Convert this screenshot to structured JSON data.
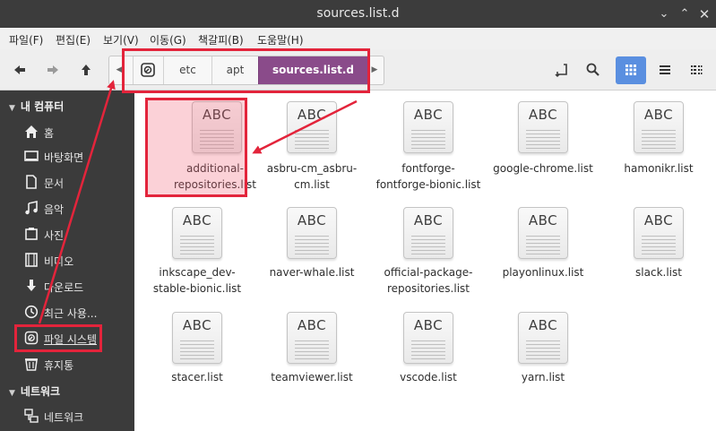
{
  "window": {
    "title": "sources.list.d",
    "minimize_glyph": "⌄",
    "maximize_glyph": "⌃",
    "close_glyph": "✕"
  },
  "menubar": [
    "파일(F)",
    "편집(E)",
    "보기(V)",
    "이동(G)",
    "책갈피(B)",
    "도움말(H)"
  ],
  "toolbar": {
    "back_icon": "arrow-left-icon",
    "forward_icon": "arrow-right-icon",
    "up_icon": "arrow-up-icon",
    "breadcrumbs": [
      "etc",
      "apt",
      "sources.list.d"
    ],
    "active_crumb": "sources.list.d",
    "view_mode": "icons"
  },
  "sidebar": {
    "sections": [
      {
        "label": "내 컴퓨터",
        "items": [
          {
            "label": "홈",
            "icon": "home-icon"
          },
          {
            "label": "바탕화면",
            "icon": "desktop-icon"
          },
          {
            "label": "문서",
            "icon": "document-icon"
          },
          {
            "label": "음악",
            "icon": "music-icon"
          },
          {
            "label": "사진",
            "icon": "picture-icon"
          },
          {
            "label": "비디오",
            "icon": "video-icon"
          },
          {
            "label": "다운로드",
            "icon": "download-icon"
          },
          {
            "label": "최근 사용...",
            "icon": "clock-icon"
          },
          {
            "label": "파일 시스템",
            "icon": "filesystem-icon"
          },
          {
            "label": "휴지통",
            "icon": "trash-icon"
          }
        ]
      },
      {
        "label": "네트워크",
        "items": [
          {
            "label": "네트워크",
            "icon": "network-icon"
          }
        ]
      }
    ],
    "selected": "파일 시스템"
  },
  "files": {
    "icon_text": "ABC",
    "items": [
      {
        "name": "additional-\nrepositories.list"
      },
      {
        "name": "asbru-cm_asbru-\ncm.list"
      },
      {
        "name": "fontforge-\nfontforge-bionic.list"
      },
      {
        "name": "google-chrome.list"
      },
      {
        "name": "hamonikr.list"
      },
      {
        "name": "inkscape_dev-\nstable-bionic.list"
      },
      {
        "name": "naver-whale.list"
      },
      {
        "name": "official-package-\nrepositories.list"
      },
      {
        "name": "playonlinux.list"
      },
      {
        "name": "slack.list"
      },
      {
        "name": "stacer.list"
      },
      {
        "name": "teamviewer.list"
      },
      {
        "name": "vscode.list"
      },
      {
        "name": "yarn.list"
      }
    ]
  },
  "annotation_color": "#e3243b",
  "accent_color": "#8a4b8a",
  "view_button_color": "#5a8fe0"
}
